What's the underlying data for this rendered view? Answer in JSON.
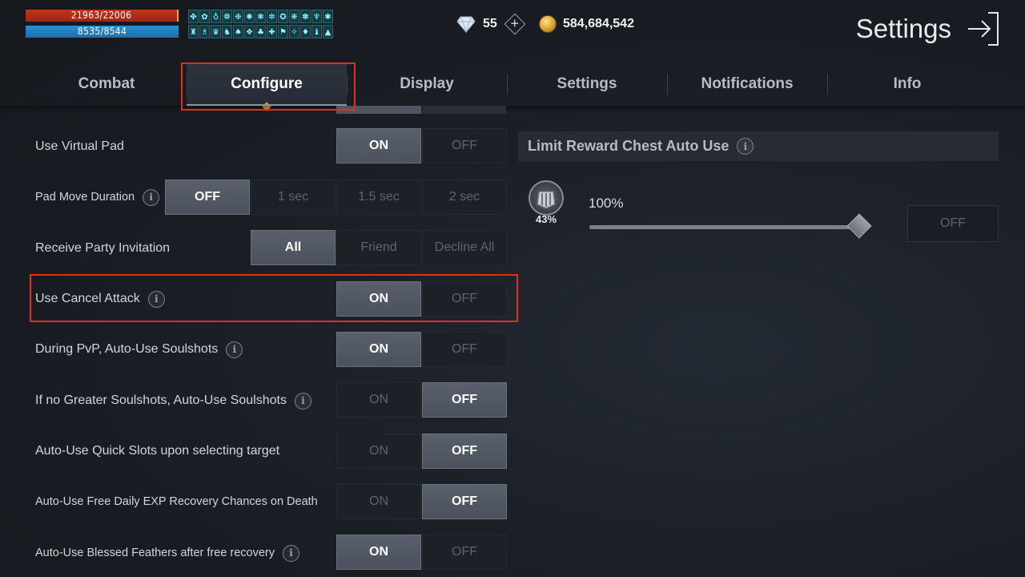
{
  "hud": {
    "hp": "21963/22006",
    "mp": "8535/8544",
    "buff_icons": [
      "✤",
      "✿",
      "♁",
      "❁",
      "❉",
      "✺",
      "❃",
      "✼",
      "✪",
      "❋",
      "✽",
      "♆",
      "✱",
      "♜",
      "♗",
      "♛",
      "♞",
      "♠",
      "❖",
      "♣",
      "✚",
      "⚑",
      "✧",
      "♦",
      "♝",
      "▲"
    ]
  },
  "currency": {
    "gems": "55",
    "gold": "584,684,542"
  },
  "page_title": "Settings",
  "tabs": [
    {
      "label": "Combat"
    },
    {
      "label": "Configure"
    },
    {
      "label": "Display"
    },
    {
      "label": "Settings"
    },
    {
      "label": "Notifications"
    },
    {
      "label": "Info"
    }
  ],
  "rows": {
    "virtual_pad": {
      "label": "Use Virtual Pad",
      "options": [
        "ON",
        "OFF"
      ],
      "selected": "ON"
    },
    "pad_move_duration": {
      "label": "Pad Move Duration",
      "options": [
        "OFF",
        "1 sec",
        "1.5 sec",
        "2 sec"
      ],
      "selected": "OFF"
    },
    "party_invitation": {
      "label": "Receive Party Invitation",
      "options": [
        "All",
        "Friend",
        "Decline All"
      ],
      "selected": "All"
    },
    "cancel_attack": {
      "label": "Use Cancel Attack",
      "options": [
        "ON",
        "OFF"
      ],
      "selected": "ON"
    },
    "pvp_soulshots": {
      "label": "During PvP, Auto-Use Soulshots",
      "options": [
        "ON",
        "OFF"
      ],
      "selected": "ON"
    },
    "greater_soulshots": {
      "label": "If no Greater Soulshots, Auto-Use Soulshots",
      "options": [
        "ON",
        "OFF"
      ],
      "selected": "OFF"
    },
    "quick_slots": {
      "label": "Auto-Use Quick Slots upon selecting target",
      "options": [
        "ON",
        "OFF"
      ],
      "selected": "OFF"
    },
    "exp_recovery": {
      "label": "Auto-Use Free Daily EXP Recovery Chances on Death",
      "options": [
        "ON",
        "OFF"
      ],
      "selected": "OFF"
    },
    "blessed_feathers": {
      "label": "Auto-Use Blessed Feathers after free recovery",
      "options": [
        "ON",
        "OFF"
      ],
      "selected": "ON"
    }
  },
  "reward_chest": {
    "title": "Limit Reward Chest Auto Use",
    "chest_percent": "43%",
    "slider_label": "100%",
    "slider_level": 1.0,
    "off_label": "OFF"
  },
  "colors": {
    "highlight": "#e0301c",
    "accent": "#f2a23a",
    "selected_option": "#545b66"
  }
}
